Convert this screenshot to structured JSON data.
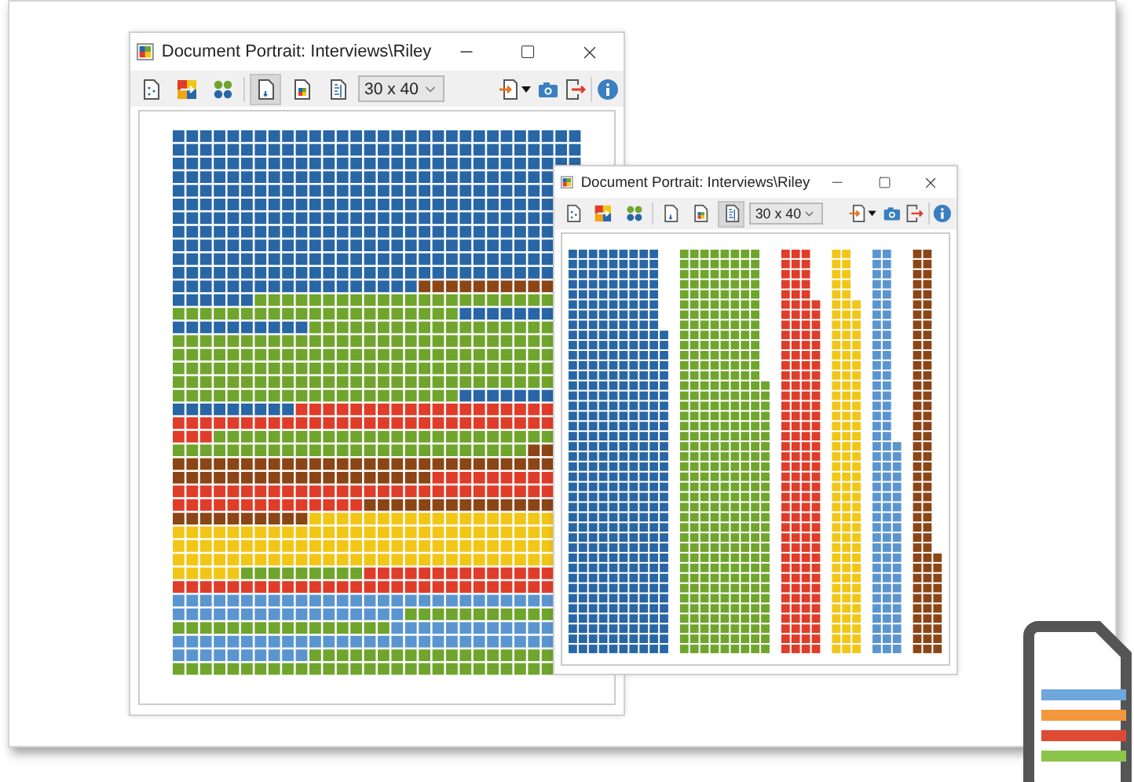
{
  "windows": [
    {
      "title": "Document Portrait: Interviews\\Riley",
      "view": {
        "kind": "grid"
      },
      "size": "30 x 40",
      "tools": [
        {
          "selected": false
        },
        {
          "selected": false
        },
        {
          "selected": false
        },
        {
          "selected": true
        },
        {
          "selected": false
        },
        {
          "selected": false
        }
      ]
    },
    {
      "title": "Document Portrait: Interviews\\Riley",
      "view": {
        "kind": "columns"
      },
      "size": "30 x 40",
      "tools": [
        {
          "selected": false
        },
        {
          "selected": false
        },
        {
          "selected": false
        },
        {
          "selected": false
        },
        {
          "selected": false
        },
        {
          "selected": true
        }
      ]
    }
  ]
}
